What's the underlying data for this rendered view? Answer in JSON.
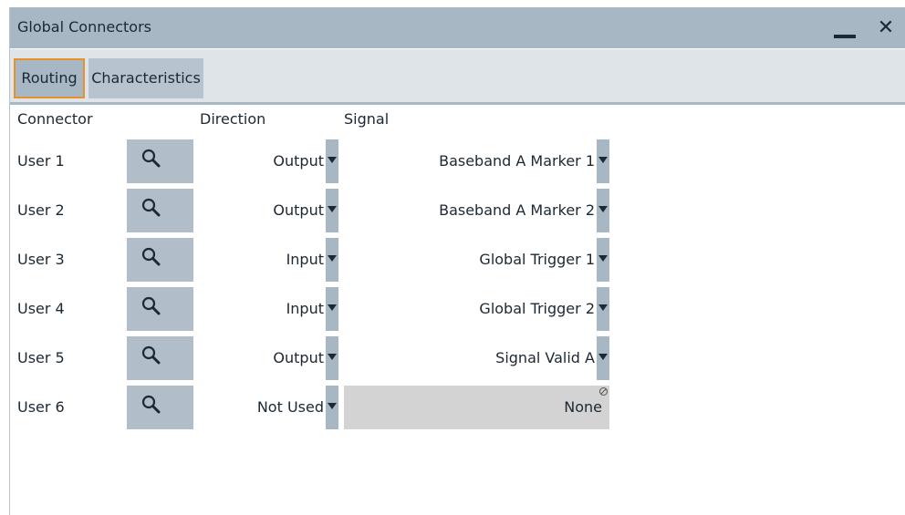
{
  "window": {
    "title": "Global Connectors",
    "minimize_icon": "minimize-icon",
    "close_icon": "close-icon",
    "close_glyph": "✕"
  },
  "tabs": [
    {
      "label": "Routing",
      "active": true
    },
    {
      "label": "Characteristics",
      "active": false
    }
  ],
  "columns": {
    "connector": "Connector",
    "direction": "Direction",
    "signal": "Signal"
  },
  "rows": [
    {
      "label": "User 1",
      "direction": "Output",
      "signal": "Baseband A Marker 1",
      "signal_enabled": true
    },
    {
      "label": "User 2",
      "direction": "Output",
      "signal": "Baseband A Marker 2",
      "signal_enabled": true
    },
    {
      "label": "User 3",
      "direction": "Input",
      "signal": "Global Trigger 1",
      "signal_enabled": true
    },
    {
      "label": "User 4",
      "direction": "Input",
      "signal": "Global Trigger 2",
      "signal_enabled": true
    },
    {
      "label": "User 5",
      "direction": "Output",
      "signal": "Signal Valid A",
      "signal_enabled": true
    },
    {
      "label": "User 6",
      "direction": "Not Used",
      "signal": "None",
      "signal_enabled": false
    }
  ],
  "colors": {
    "titlebar": "#a8b7c4",
    "tab_active_border": "#e8902a",
    "button": "#b1bec9",
    "disabled_field": "#d3d3d3"
  }
}
